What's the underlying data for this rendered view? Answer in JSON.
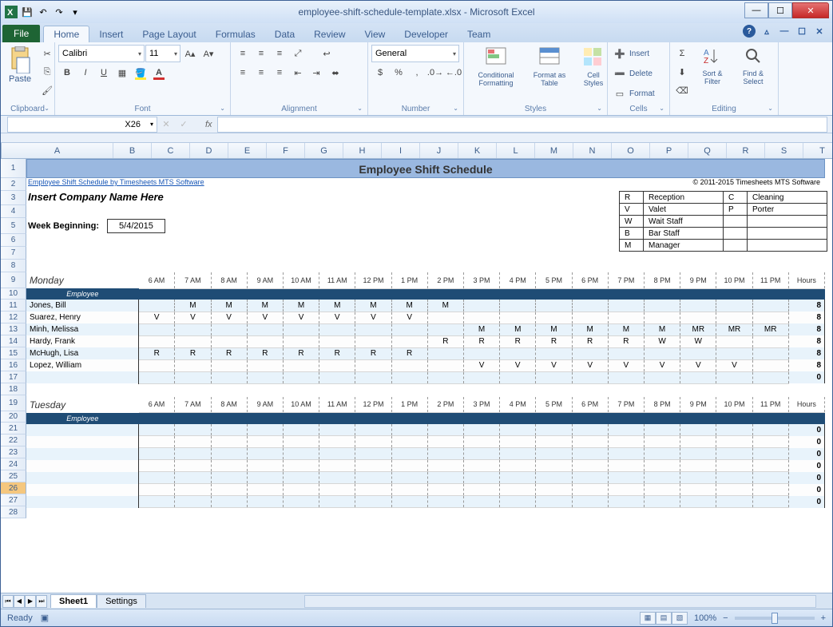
{
  "window_title": "employee-shift-schedule-template.xlsx - Microsoft Excel",
  "ribbon": {
    "file": "File",
    "tabs": [
      "Home",
      "Insert",
      "Page Layout",
      "Formulas",
      "Data",
      "Review",
      "View",
      "Developer",
      "Team"
    ],
    "active_tab": "Home",
    "font_name": "Calibri",
    "font_size": "11",
    "number_format": "General",
    "groups": {
      "clipboard": "Clipboard",
      "paste": "Paste",
      "font": "Font",
      "alignment": "Alignment",
      "number": "Number",
      "styles": "Styles",
      "cells": "Cells",
      "editing": "Editing",
      "cond_fmt": "Conditional Formatting",
      "fmt_table": "Format as Table",
      "cell_styles": "Cell Styles",
      "insert": "Insert",
      "delete": "Delete",
      "format": "Format",
      "sort": "Sort & Filter",
      "find": "Find & Select"
    }
  },
  "name_box": "X26",
  "formula": "",
  "columns": [
    "A",
    "B",
    "C",
    "D",
    "E",
    "F",
    "G",
    "H",
    "I",
    "J",
    "K",
    "L",
    "M",
    "N",
    "O",
    "P",
    "Q",
    "R",
    "S",
    "T"
  ],
  "sheet": {
    "title": "Employee Shift Schedule",
    "link": "Employee Shift Schedule by Timesheets MTS Software",
    "copyright": "© 2011-2015 Timesheets MTS Software",
    "company_placeholder": "Insert Company Name Here",
    "week_label": "Week Beginning:",
    "week_date": "5/4/2015",
    "legend": [
      {
        "code": "R",
        "name": "Reception"
      },
      {
        "code": "V",
        "name": "Valet"
      },
      {
        "code": "W",
        "name": "Wait Staff"
      },
      {
        "code": "B",
        "name": "Bar Staff"
      },
      {
        "code": "M",
        "name": "Manager"
      },
      {
        "code": "C",
        "name": "Cleaning"
      },
      {
        "code": "P",
        "name": "Porter"
      }
    ],
    "times": [
      "6 AM",
      "7 AM",
      "8 AM",
      "9 AM",
      "10 AM",
      "11 AM",
      "12 PM",
      "1 PM",
      "2 PM",
      "3 PM",
      "4 PM",
      "5 PM",
      "6 PM",
      "7 PM",
      "8 PM",
      "9 PM",
      "10 PM",
      "11 PM"
    ],
    "hours_label": "Hours",
    "employee_label": "Employee",
    "days": [
      {
        "name": "Monday",
        "rows": [
          {
            "name": "Jones, Bill",
            "cells": [
              "",
              "M",
              "M",
              "M",
              "M",
              "M",
              "M",
              "M",
              "M",
              "",
              "",
              "",
              "",
              "",
              "",
              "",
              "",
              ""
            ],
            "hours": "8"
          },
          {
            "name": "Suarez, Henry",
            "cells": [
              "V",
              "V",
              "V",
              "V",
              "V",
              "V",
              "V",
              "V",
              "",
              "",
              "",
              "",
              "",
              "",
              "",
              "",
              "",
              ""
            ],
            "hours": "8"
          },
          {
            "name": "Minh, Melissa",
            "cells": [
              "",
              "",
              "",
              "",
              "",
              "",
              "",
              "",
              "",
              "M",
              "M",
              "M",
              "M",
              "M",
              "M",
              "MR",
              "MR",
              "MR"
            ],
            "hours": "8"
          },
          {
            "name": "Hardy, Frank",
            "cells": [
              "",
              "",
              "",
              "",
              "",
              "",
              "",
              "",
              "R",
              "R",
              "R",
              "R",
              "R",
              "R",
              "W",
              "W",
              "",
              ""
            ],
            "hours": "8"
          },
          {
            "name": "McHugh, Lisa",
            "cells": [
              "R",
              "R",
              "R",
              "R",
              "R",
              "R",
              "R",
              "R",
              "",
              "",
              "",
              "",
              "",
              "",
              "",
              "",
              "",
              ""
            ],
            "hours": "8"
          },
          {
            "name": "Lopez, William",
            "cells": [
              "",
              "",
              "",
              "",
              "",
              "",
              "",
              "",
              "",
              "V",
              "V",
              "V",
              "V",
              "V",
              "V",
              "V",
              "V",
              ""
            ],
            "hours": "8"
          },
          {
            "name": "",
            "cells": [
              "",
              "",
              "",
              "",
              "",
              "",
              "",
              "",
              "",
              "",
              "",
              "",
              "",
              "",
              "",
              "",
              "",
              ""
            ],
            "hours": "0"
          }
        ]
      },
      {
        "name": "Tuesday",
        "rows": [
          {
            "name": "",
            "cells": [
              "",
              "",
              "",
              "",
              "",
              "",
              "",
              "",
              "",
              "",
              "",
              "",
              "",
              "",
              "",
              "",
              "",
              ""
            ],
            "hours": "0"
          },
          {
            "name": "",
            "cells": [
              "",
              "",
              "",
              "",
              "",
              "",
              "",
              "",
              "",
              "",
              "",
              "",
              "",
              "",
              "",
              "",
              "",
              ""
            ],
            "hours": "0"
          },
          {
            "name": "",
            "cells": [
              "",
              "",
              "",
              "",
              "",
              "",
              "",
              "",
              "",
              "",
              "",
              "",
              "",
              "",
              "",
              "",
              "",
              ""
            ],
            "hours": "0"
          },
          {
            "name": "",
            "cells": [
              "",
              "",
              "",
              "",
              "",
              "",
              "",
              "",
              "",
              "",
              "",
              "",
              "",
              "",
              "",
              "",
              "",
              ""
            ],
            "hours": "0"
          },
          {
            "name": "",
            "cells": [
              "",
              "",
              "",
              "",
              "",
              "",
              "",
              "",
              "",
              "",
              "",
              "",
              "",
              "",
              "",
              "",
              "",
              ""
            ],
            "hours": "0"
          },
          {
            "name": "",
            "cells": [
              "",
              "",
              "",
              "",
              "",
              "",
              "",
              "",
              "",
              "",
              "",
              "",
              "",
              "",
              "",
              "",
              "",
              ""
            ],
            "hours": "0"
          },
          {
            "name": "",
            "cells": [
              "",
              "",
              "",
              "",
              "",
              "",
              "",
              "",
              "",
              "",
              "",
              "",
              "",
              "",
              "",
              "",
              "",
              ""
            ],
            "hours": "0"
          }
        ]
      }
    ]
  },
  "sheet_tabs": [
    "Sheet1",
    "Settings"
  ],
  "status": {
    "ready": "Ready",
    "zoom": "100%"
  }
}
